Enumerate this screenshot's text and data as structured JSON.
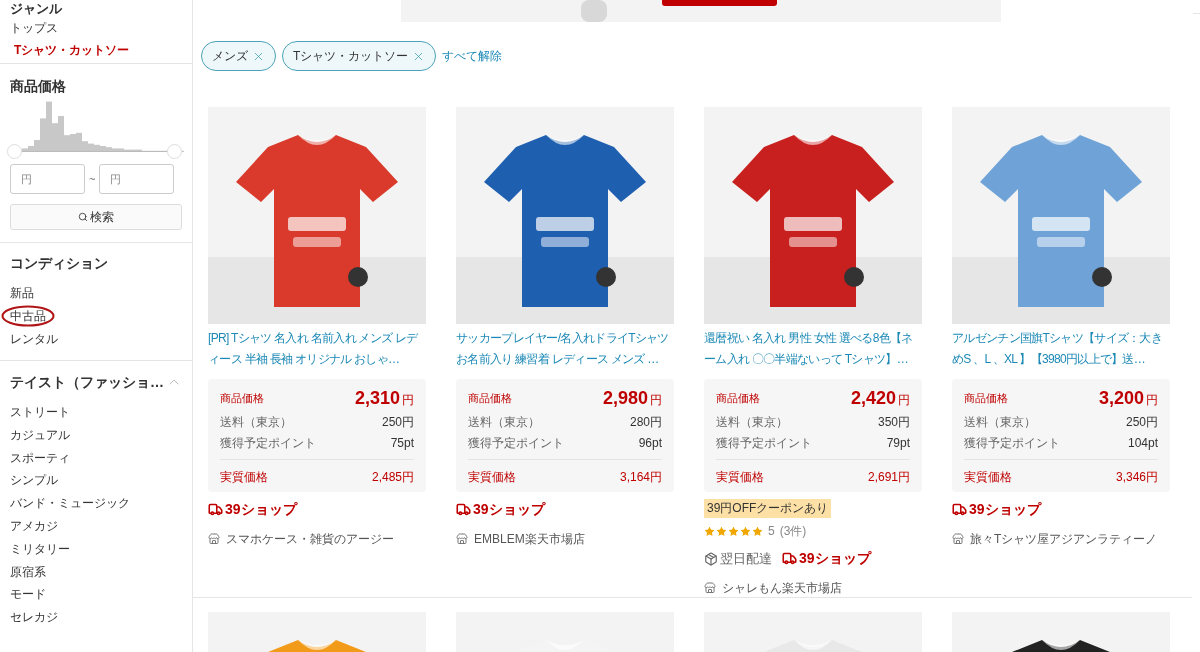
{
  "sidebar": {
    "genre": {
      "title": "ジャンル",
      "items": [
        {
          "label": "トップス",
          "selected": false
        },
        {
          "label": "Tシャツ・カットソー",
          "selected": true
        }
      ]
    },
    "price": {
      "title": "商品価格",
      "min_placeholder": "円",
      "separator": "~",
      "max_placeholder": "円",
      "search_button": "検索"
    },
    "condition": {
      "title": "コンディション",
      "items": [
        {
          "label": "新品",
          "circled": false
        },
        {
          "label": "中古品",
          "circled": true
        },
        {
          "label": "レンタル",
          "circled": false
        }
      ]
    },
    "taste": {
      "title": "テイスト（ファッショ…",
      "expanded": true,
      "items": [
        "ストリート",
        "カジュアル",
        "スポーティ",
        "シンプル",
        "バンド・ミュージック",
        "アメカジ",
        "ミリタリー",
        "原宿系",
        "モード",
        "セレカジ"
      ]
    }
  },
  "filters": {
    "chips": [
      {
        "label": "メンズ"
      },
      {
        "label": "Tシャツ・カットソー"
      }
    ],
    "clear_all": "すべて解除"
  },
  "products": [
    {
      "title": "[PR] Tシャツ 名入れ 名前入れ メンズ レディース 半袖 長袖 オリジナル おしゃ…",
      "price_label": "商品価格",
      "price": "2,310",
      "yen": "円",
      "shipping_label": "送料（東京）",
      "shipping": "250円",
      "points_label": "獲得予定ポイント",
      "points": "75pt",
      "effective_label": "実質価格",
      "effective": "2,485円",
      "shop_badge": "39ショップ",
      "store": "スマホケース・雑貨のアージー"
    },
    {
      "title": "サッカープレイヤー/名入れドライTシャツお名前入り 練習着 レディース メンズ …",
      "price_label": "商品価格",
      "price": "2,980",
      "yen": "円",
      "shipping_label": "送料（東京）",
      "shipping": "280円",
      "points_label": "獲得予定ポイント",
      "points": "96pt",
      "effective_label": "実質価格",
      "effective": "3,164円",
      "shop_badge": "39ショップ",
      "store": "EMBLEM楽天市場店"
    },
    {
      "title": "還暦祝い 名入れ 男性 女性 選べる8色【ネーム入れ 〇〇半端ないって Tシャツ】…",
      "price_label": "商品価格",
      "price": "2,420",
      "yen": "円",
      "shipping_label": "送料（東京）",
      "shipping": "350円",
      "points_label": "獲得予定ポイント",
      "points": "79pt",
      "effective_label": "実質価格",
      "effective": "2,691円",
      "coupon": "39円OFFクーポンあり",
      "stars": 5,
      "rating": "5",
      "reviews": "(3件)",
      "next_day": "翌日配達",
      "shop_badge": "39ショップ",
      "store": "シャレもん楽天市場店"
    },
    {
      "title": "アルゼンチン国旗Tシャツ【サイズ：大きめS 、L 、XL 】【3980円以上で】送…",
      "price_label": "商品価格",
      "price": "3,200",
      "yen": "円",
      "shipping_label": "送料（東京）",
      "shipping": "250円",
      "points_label": "獲得予定ポイント",
      "points": "104pt",
      "effective_label": "実質価格",
      "effective": "3,346円",
      "shop_badge": "39ショップ",
      "store": "旅々Tシャツ屋アジアンラティーノ"
    }
  ]
}
